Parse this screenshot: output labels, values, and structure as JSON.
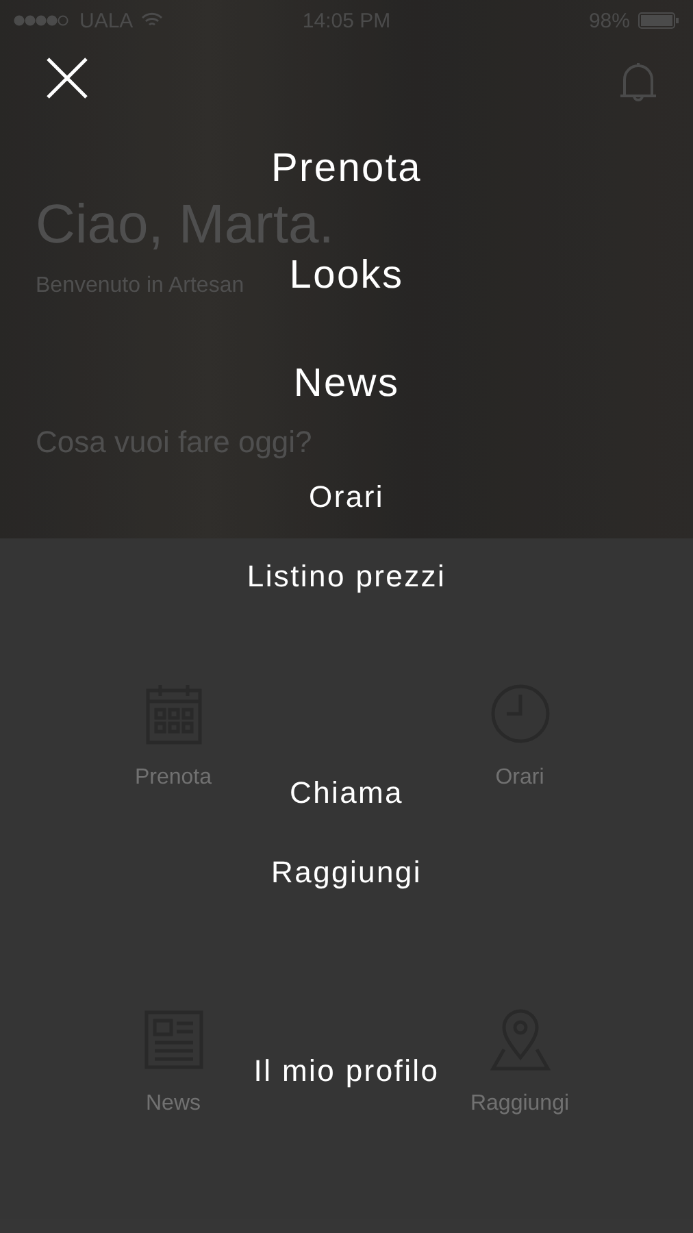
{
  "status_bar": {
    "carrier": "UALA",
    "time": "14:05 PM",
    "battery": "98%"
  },
  "header": {
    "greeting": "Ciao, Marta.",
    "subtitle": "Benvenuto in Artesan",
    "prompt": "Cosa vuoi fare oggi?"
  },
  "actions": [
    {
      "label": "Prenota",
      "kind": "calendar"
    },
    {
      "label": "Orari",
      "kind": "clock"
    },
    {
      "label": "News",
      "kind": "newspaper"
    },
    {
      "label": "Raggiungi",
      "kind": "pin"
    }
  ],
  "menu": {
    "items": [
      {
        "label": "Prenota",
        "kind": "primary"
      },
      {
        "label": "Looks",
        "kind": "primary"
      },
      {
        "label": "News",
        "kind": "primary"
      },
      {
        "label": "Orari",
        "kind": "secondary"
      },
      {
        "label": "Listino prezzi",
        "kind": "secondary"
      },
      {
        "label": "Chiama",
        "kind": "secondary"
      },
      {
        "label": "Raggiungi",
        "kind": "secondary"
      },
      {
        "label": "Il mio profilo",
        "kind": "secondary"
      }
    ]
  }
}
